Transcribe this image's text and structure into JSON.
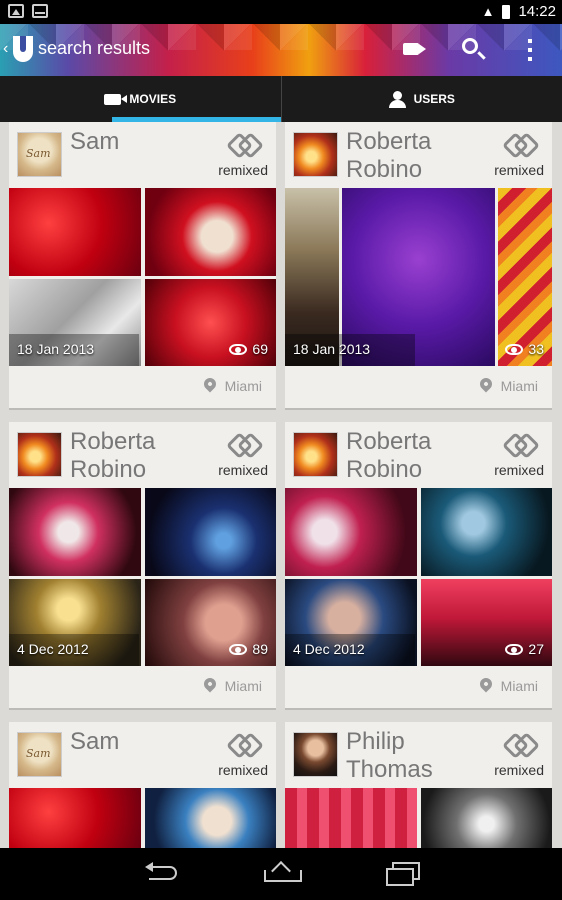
{
  "status_bar": {
    "time": "14:22"
  },
  "action_bar": {
    "title": "search results"
  },
  "tabs": [
    {
      "label": "MOVIES",
      "active": true,
      "icon": "video-camera-icon"
    },
    {
      "label": "USERS",
      "active": false,
      "icon": "user-icon"
    }
  ],
  "cards": [
    {
      "user": "Sam",
      "avatar": "sam",
      "badge": "remixed",
      "date": "18 Jan 2013",
      "views": "69",
      "location": "Miami"
    },
    {
      "user": "Roberta Robino",
      "avatar": "rob",
      "badge": "remixed",
      "date": "18 Jan 2013",
      "views": "33",
      "location": "Miami"
    },
    {
      "user": "Roberta Robino",
      "avatar": "rob",
      "badge": "remixed",
      "date": "4 Dec 2012",
      "views": "89",
      "location": "Miami"
    },
    {
      "user": "Roberta Robino",
      "avatar": "rob",
      "badge": "remixed",
      "date": "4 Dec 2012",
      "views": "27",
      "location": "Miami"
    },
    {
      "user": "Sam",
      "avatar": "sam",
      "badge": "remixed"
    },
    {
      "user": "Philip Thomas",
      "avatar": "phil",
      "badge": "remixed"
    }
  ],
  "colors": {
    "accent": "#33b5e5",
    "card_bg": "#f1efec",
    "page_bg": "#dcdad6"
  }
}
